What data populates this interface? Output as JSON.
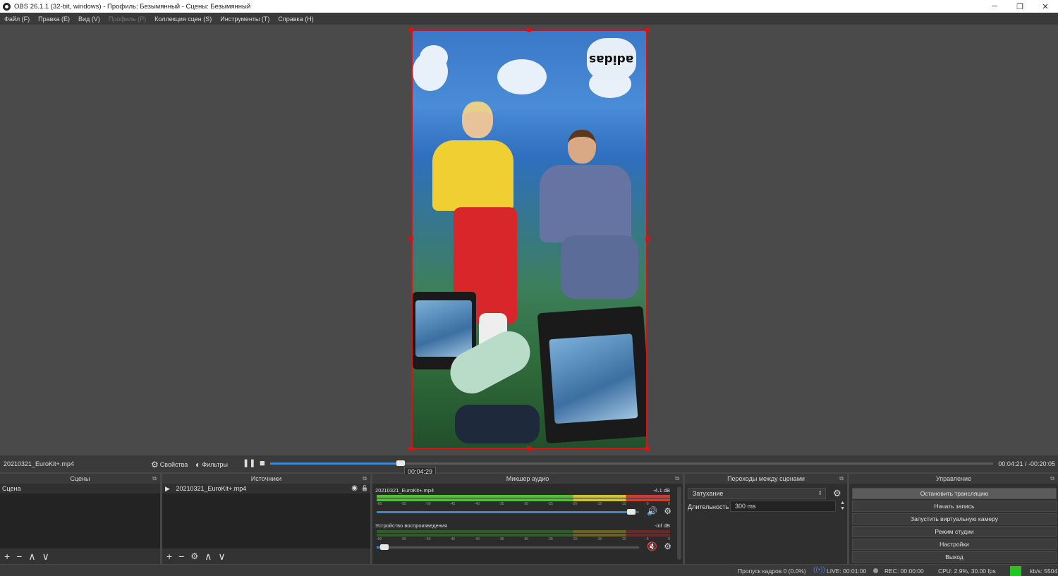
{
  "window": {
    "title": "OBS 26.1.1 (32-bit, windows) - Профиль: Безымянный - Сцены: Безымянный",
    "minimize_glyph": "─",
    "restore_glyph": "❐",
    "close_glyph": "✕"
  },
  "menu": [
    "Файл (F)",
    "Правка (E)",
    "Вид (V)",
    "Профиль (P)",
    "Коллекция сцен (S)",
    "Инструменты (T)",
    "Справка (H)"
  ],
  "preview": {
    "logo_text": "adidas",
    "selection_color": "#e01010"
  },
  "media": {
    "source_name": "20210321_EuroKit+.mp4",
    "properties_label": "Свойства",
    "filters_label": "Фильтры",
    "pause_glyph": "❚❚",
    "stop_glyph": "■",
    "seek_tooltip": "00:04:29",
    "time_readout": "00:04:21 / -00:20:05",
    "progress_fraction": 0.18
  },
  "scenes": {
    "title": "Сцены",
    "items": [
      "Сцена"
    ],
    "footer": [
      "+",
      "−",
      "∧",
      "∨"
    ]
  },
  "sources": {
    "title": "Источники",
    "items": [
      {
        "name": "20210321_EuroKit+.mp4",
        "play_glyph": "▶",
        "eye_glyph": "◉",
        "lock_glyph": "🔓"
      }
    ],
    "footer": [
      "+",
      "−",
      "⚙",
      "∧",
      "∨"
    ]
  },
  "mixer": {
    "title": "Микшер аудио",
    "ticks": [
      "-60",
      "-55",
      "-50",
      "-45",
      "-40",
      "-35",
      "-30",
      "-25",
      "-20",
      "-15",
      "-10",
      "-5",
      "0"
    ],
    "channels": [
      {
        "name": "20210321_EuroKit+.mp4",
        "db": "-4.1 dB",
        "volume_fraction": 0.97,
        "muted": false,
        "speaker_glyph": "🔊",
        "gear_glyph": "⚙"
      },
      {
        "name": "Устройство воспроизведения",
        "db": "-inf dB",
        "volume_fraction": 0.03,
        "muted": true,
        "speaker_glyph": "🔇",
        "gear_glyph": "⚙"
      }
    ]
  },
  "transitions": {
    "title": "Переходы между сценами",
    "selected": "Затухание",
    "duration_label": "Длительность",
    "duration_value": "300 ms"
  },
  "controls": {
    "title": "Управление",
    "buttons": [
      "Остановить трансляцию",
      "Начать запись",
      "Запустить виртуальную камеру",
      "Режим студии",
      "Настройки",
      "Выход"
    ]
  },
  "status": {
    "dropped_frames": "Пропуск кадров 0 (0.0%)",
    "live": "LIVE: 00:01:00",
    "rec": "REC: 00:00:00",
    "cpu": "CPU: 2.9%, 30.00 fps",
    "bitrate": "kb/s: 5504",
    "health_color": "#1ec81e"
  },
  "dock_popout_glyph": "⧉"
}
